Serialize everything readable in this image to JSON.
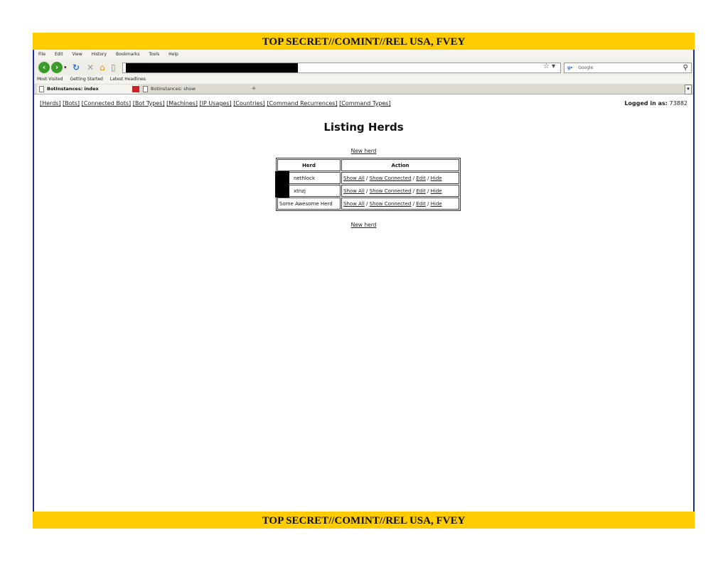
{
  "classification": {
    "top": "TOP SECRET//COMINT//REL USA, FVEY",
    "bottom": "TOP SECRET//COMINT//REL USA, FVEY"
  },
  "menu": {
    "file": "File",
    "edit": "Edit",
    "view": "View",
    "history": "History",
    "bookmarks": "Bookmarks",
    "tools": "Tools",
    "help": "Help"
  },
  "search": {
    "engine": "Google"
  },
  "bookmarks": {
    "most_visited": "Most Visited",
    "getting_started": "Getting Started",
    "latest_headlines": "Latest Headlines"
  },
  "tabs": {
    "active": "BotInstances: index",
    "inactive": "BotInstances: show"
  },
  "topnav": {
    "herds": "[Herds]",
    "bots": "[Bots]",
    "connected_bots": "[Connected Bots]",
    "bot_types": "[Bot Types]",
    "machines": "[Machines]",
    "ip_usages": "[IP Usages]",
    "countries": "[Countries]",
    "command_recurrences": "[Command Recurrences]",
    "command_types": "[Command Types]"
  },
  "login": {
    "label": "Logged in as:",
    "user": "73882"
  },
  "page": {
    "title": "Listing Herds",
    "new_herd_top": "New herd",
    "new_herd_bottom": "New herd"
  },
  "table": {
    "headers": {
      "herd": "Herd",
      "action": "Action"
    },
    "rows": [
      {
        "herd": "nethlock",
        "show_all": "Show All",
        "show_connected": "Show Connected",
        "edit": "Edit",
        "hide": "Hide"
      },
      {
        "herd": "xtnzj",
        "show_all": "Show All",
        "show_connected": "Show Connected",
        "edit": "Edit",
        "hide": "Hide"
      },
      {
        "herd": "Some Awesome Herd",
        "show_all": "Show All",
        "show_connected": "Show Connected",
        "edit": "Edit",
        "hide": "Hide"
      }
    ],
    "separator": "/"
  },
  "colors": {
    "banner": "#ffcc00",
    "border": "#1a2f9e",
    "nav_green": "#3a9a2a"
  }
}
